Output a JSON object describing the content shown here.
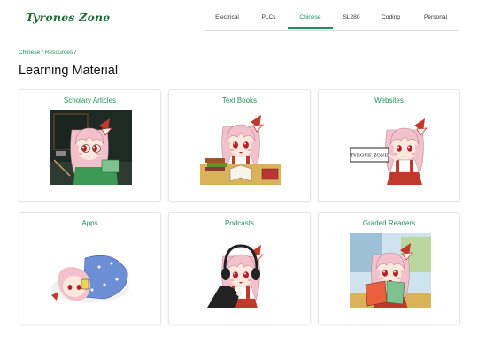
{
  "brand": {
    "logo_text": "Tyrones Zone"
  },
  "nav": {
    "items": [
      {
        "label": "Electrical",
        "active": false
      },
      {
        "label": "PLCs",
        "active": false
      },
      {
        "label": "Chinese",
        "active": true
      },
      {
        "label": "SL280",
        "active": false
      },
      {
        "label": "Coding",
        "active": false
      },
      {
        "label": "Personal",
        "active": false
      }
    ]
  },
  "breadcrumb": {
    "items": [
      "Chinese",
      "Resources"
    ],
    "separator": "/"
  },
  "page": {
    "title": "Learning Material"
  },
  "cards": [
    {
      "title": "Scholary Articles",
      "image": "scholar-character-blackboard-illustration"
    },
    {
      "title": "Text Books",
      "image": "character-studying-books-illustration"
    },
    {
      "title": "Websites",
      "image": "character-holding-sign-illustration",
      "sign_text": "TYRONE ZONE"
    },
    {
      "title": "Apps",
      "image": "character-sleeping-bag-phone-illustration"
    },
    {
      "title": "Podcasts",
      "image": "character-headphones-illustration"
    },
    {
      "title": "Graded Readers",
      "image": "character-reading-book-illustration"
    }
  ],
  "colors": {
    "accent": "#1e8f5a",
    "logo": "#1f6b34",
    "hair": "#f3c1cb",
    "bow": "#c0392b"
  }
}
